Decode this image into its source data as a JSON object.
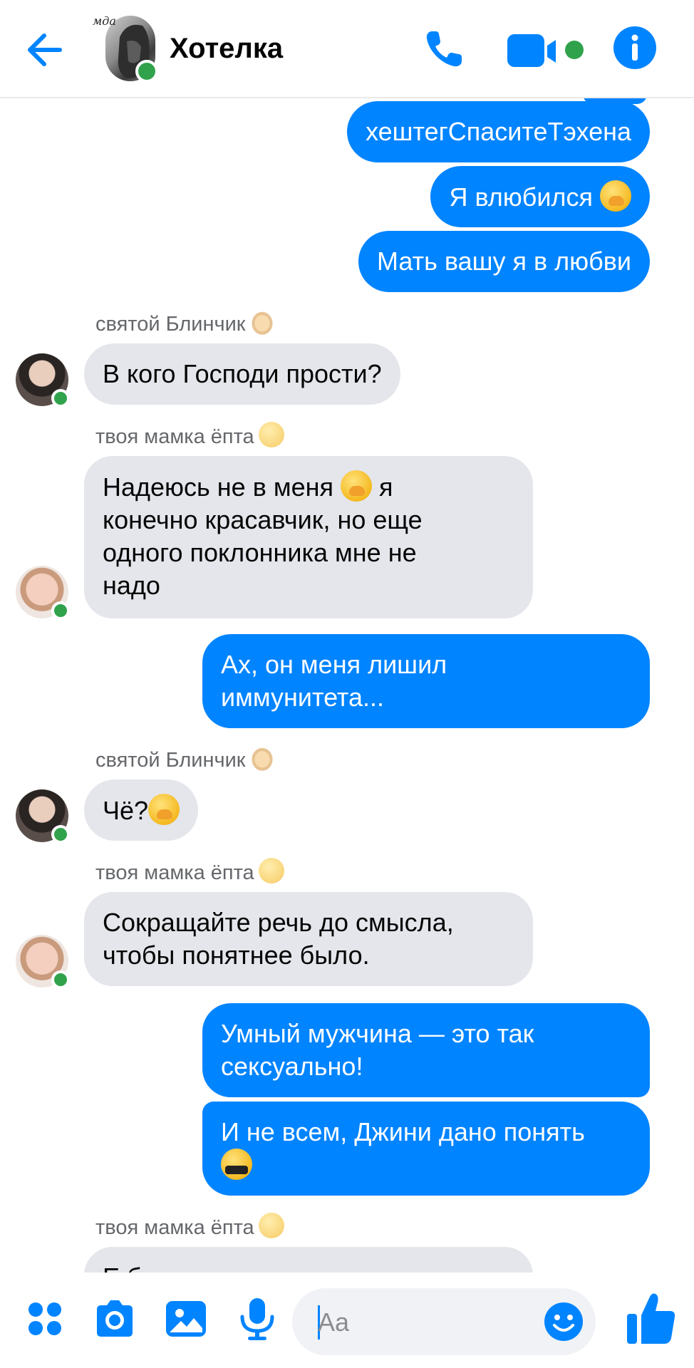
{
  "header": {
    "title": "Хотелка",
    "avatar_caption": "мда",
    "accent": "#0084ff",
    "online_color": "#31a24c"
  },
  "messages": {
    "m1": "хештегСпаситеТэхена",
    "m2": "Я влюбился",
    "m3": "Мать вашу я в любви",
    "s1": "святой Блинчик",
    "m4": "В кого Господи прости?",
    "s2": "твоя мамка ёпта",
    "m5_line1": "Надеюсь не в меня",
    "m5_line1b": "я",
    "m5_line2": "конечно красавчик, но еще",
    "m5_line3": "одного поклонника мне не",
    "m5_line4": "надо",
    "m6_line1": "Ах, он меня лишил",
    "m6_line2": "иммунитета...",
    "s3": "святой Блинчик",
    "m7": "Чё?",
    "s4": "твоя мамка ёпта",
    "m8_line1": "Сокращайте речь до смысла,",
    "m8_line2": "чтобы понятнее было.",
    "m9_line1": "Умный мужчина — это так",
    "m9_line2": "сексуально!",
    "m10_line1": "И не всем, Джини дано понять",
    "s5": "твоя мамка ёпта",
    "m11_partial": "Е                б"
  },
  "composer": {
    "placeholder": "Aa"
  },
  "icons": {
    "back": "arrow-left-icon",
    "call": "phone-icon",
    "video": "video-camera-icon",
    "info": "info-icon",
    "menu": "four-dots-icon",
    "camera": "camera-icon",
    "gallery": "image-icon",
    "mic": "microphone-icon",
    "emoji": "smiley-icon",
    "like": "thumbs-up-icon"
  }
}
